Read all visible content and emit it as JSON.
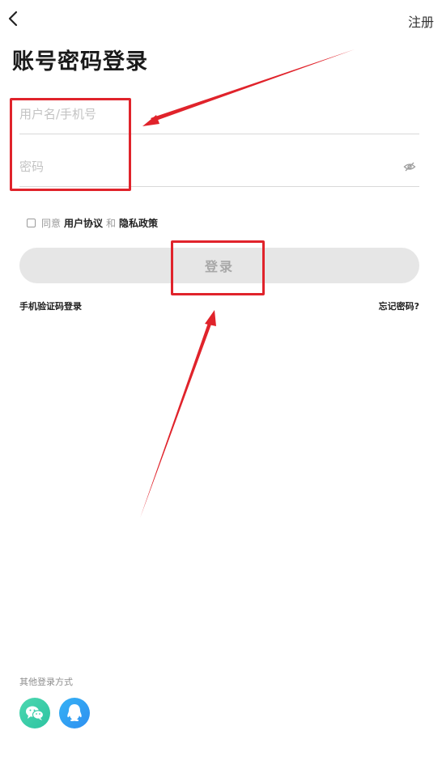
{
  "header": {
    "back_icon": "chevron-left-icon",
    "register_label": "注册"
  },
  "title": "账号密码登录",
  "form": {
    "username_placeholder": "用户名/手机号",
    "password_placeholder": "密码",
    "toggle_visibility_icon": "eye-off-icon"
  },
  "agreement": {
    "prefix": "同意",
    "user_agreement": "用户协议",
    "and": "和",
    "privacy_policy": "隐私政策",
    "checked": false
  },
  "login_button": "登录",
  "links": {
    "sms_login": "手机验证码登录",
    "forgot_password": "忘记密码?"
  },
  "other_login": {
    "label": "其他登录方式",
    "providers": [
      {
        "icon": "wechat-icon",
        "color": "#2fc6a3"
      },
      {
        "icon": "qq-icon",
        "color": "#3199f2"
      }
    ]
  },
  "annotation_color": "#e0232b"
}
